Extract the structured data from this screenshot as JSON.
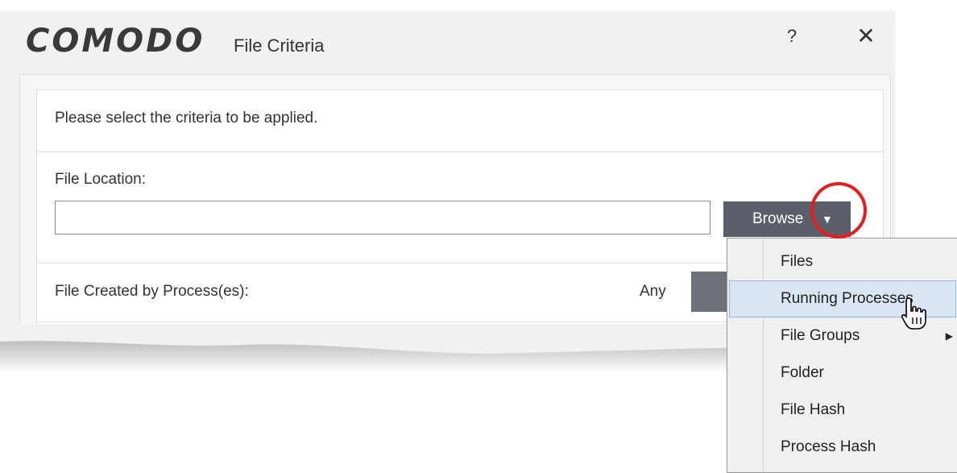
{
  "window": {
    "brand": "COMODO",
    "title": "File Criteria",
    "help_label": "?",
    "close_label": "✕"
  },
  "form": {
    "instruction": "Please select the criteria to be applied.",
    "file_location_label": "File Location:",
    "file_location_value": "",
    "browse_label": "Browse",
    "browse_arrow": "▼",
    "process_label": "File Created by Process(es):",
    "process_value": "Any"
  },
  "browse_menu": {
    "items": [
      {
        "label": "Files"
      },
      {
        "label": "Running Processes",
        "highlighted": true
      },
      {
        "label": "File Groups",
        "has_submenu": true,
        "submenu_arrow": "▶"
      },
      {
        "label": "Folder"
      },
      {
        "label": "File Hash"
      },
      {
        "label": "Process Hash"
      }
    ]
  },
  "colors": {
    "browse_button": "#5a5f69",
    "highlight": "#d9e5f3",
    "annotation_circle": "#e41e1e"
  }
}
